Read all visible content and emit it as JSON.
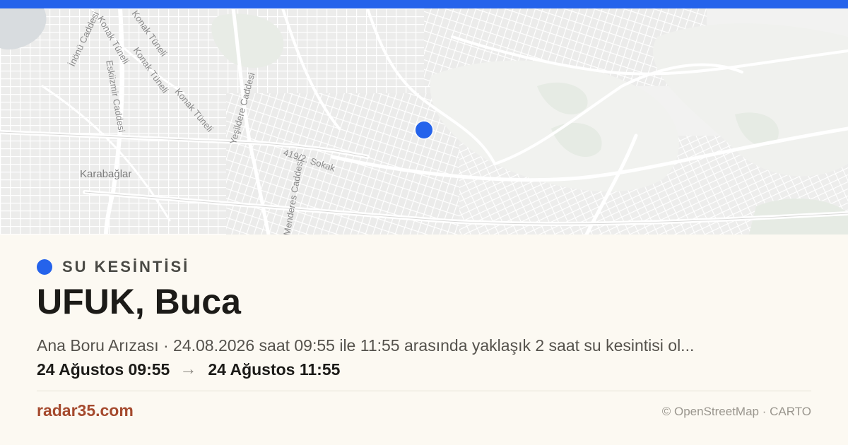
{
  "map": {
    "labels": {
      "inonu": "İnönü Caddesi",
      "eskiizmir": "Eskiizmir Caddesi",
      "konak1": "Konak Tüneli",
      "konak2": "Konak Tüneli",
      "konak3": "Konak Tüneli",
      "konak4": "Konak Tüneli",
      "yesildere": "Yeşildere Caddesi",
      "sokak": "419/2. Sokak",
      "menderes": "Menderes Caddesi",
      "karabaglar": "Karabağlar"
    },
    "marker_color": "#2563eb"
  },
  "category": {
    "label": "SU KESİNTİSİ",
    "color": "#2563eb"
  },
  "title": "UFUK, Buca",
  "description": "Ana Boru Arızası · 24.08.2026 saat 09:55 ile 11:55 arasında yaklaşık 2 saat su kesintisi ol...",
  "times": {
    "start": "24 Ağustos 09:55",
    "arrow": "→",
    "end": "24 Ağustos 11:55"
  },
  "footer": {
    "brand": "radar35.com",
    "attribution": "© OpenStreetMap · CARTO"
  },
  "colors": {
    "accent": "#2563eb",
    "brand": "#a54a2e",
    "background": "#fcf9f2"
  }
}
